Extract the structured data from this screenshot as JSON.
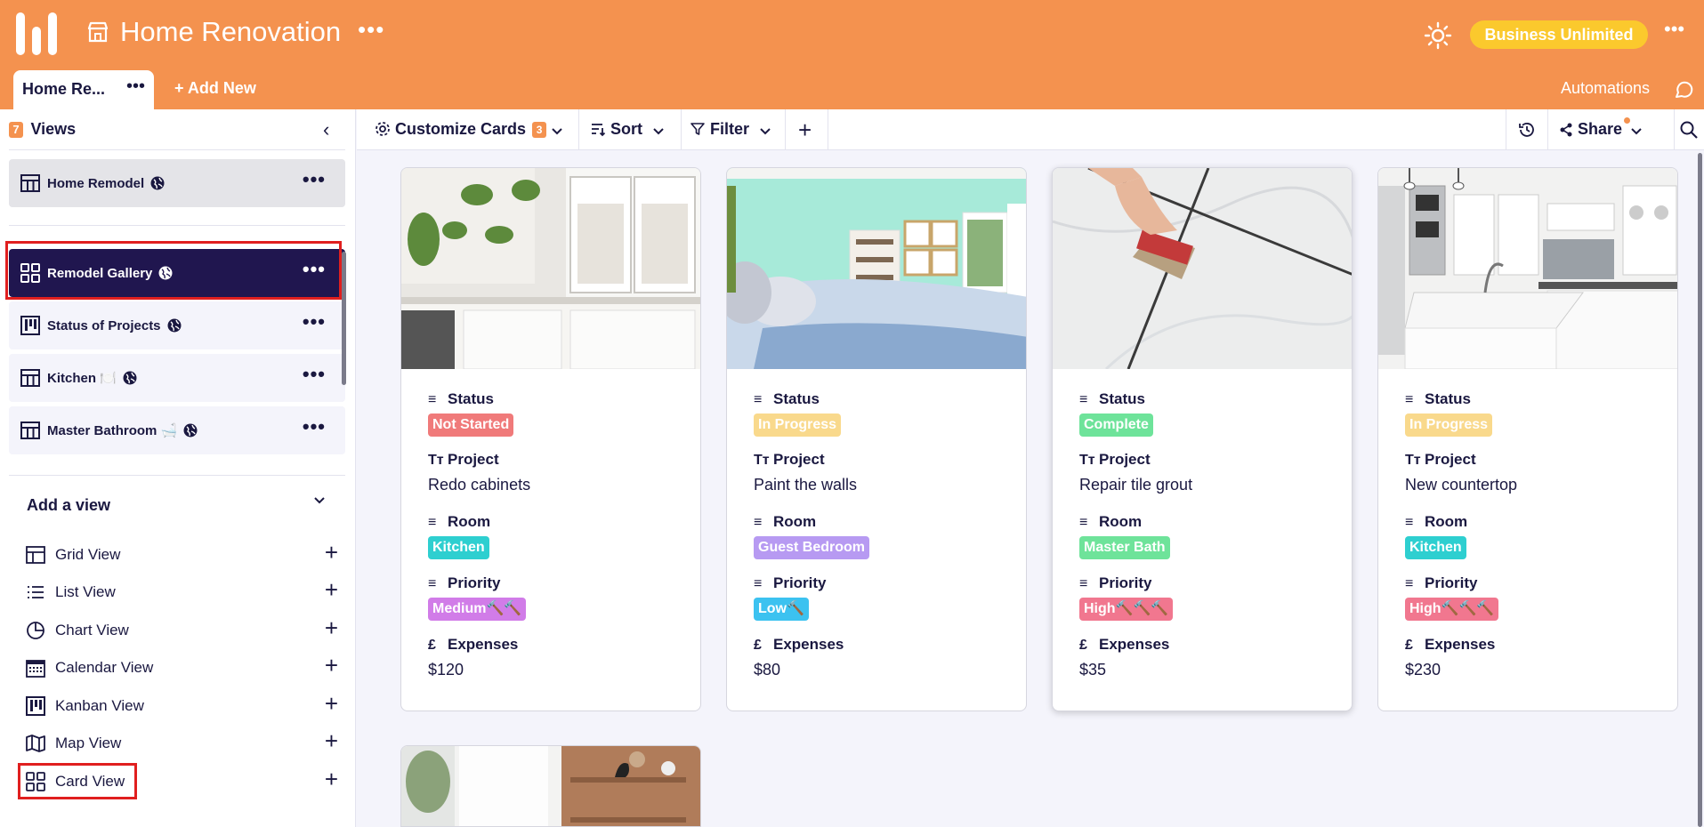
{
  "app": {
    "title": "Home Renovation",
    "plan": "Business Unlimited",
    "tab_active": "Home Re...",
    "add_new": "+ Add New",
    "automations": "Automations"
  },
  "sidebar": {
    "views_count": "7",
    "views_label": "Views",
    "views": [
      {
        "label": "Home Remodel",
        "icon": "grid-table-icon"
      },
      {
        "label": "Remodel Gallery",
        "icon": "gallery-icon",
        "active": true
      },
      {
        "label": "Status of Projects",
        "icon": "kanban-icon"
      },
      {
        "label": "Kitchen 🍽️",
        "icon": "grid-table-icon"
      },
      {
        "label": "Master Bathroom 🛁",
        "icon": "grid-table-icon"
      }
    ],
    "add_view_title": "Add a view",
    "add_views": [
      {
        "label": "Grid View",
        "icon": "grid-view-icon"
      },
      {
        "label": "List View",
        "icon": "list-view-icon"
      },
      {
        "label": "Chart View",
        "icon": "chart-view-icon"
      },
      {
        "label": "Calendar View",
        "icon": "calendar-view-icon"
      },
      {
        "label": "Kanban View",
        "icon": "kanban-view-icon"
      },
      {
        "label": "Map View",
        "icon": "map-view-icon"
      },
      {
        "label": "Card View",
        "icon": "card-view-icon"
      }
    ]
  },
  "toolbar": {
    "customize": "Customize Cards",
    "customize_count": "3",
    "sort": "Sort",
    "filter": "Filter",
    "share": "Share"
  },
  "field_labels": {
    "status": "Status",
    "project": "Project",
    "room": "Room",
    "priority": "Priority",
    "expenses": "Expenses"
  },
  "cards": [
    {
      "status": "Not Started",
      "status_color": "#f07a7a",
      "project": "Redo cabinets",
      "room": "Kitchen",
      "room_color": "#2ecfd0",
      "priority": "Medium🔨🔨",
      "priority_color": "#d17ce8",
      "expenses": "$120"
    },
    {
      "status": "In Progress",
      "status_color": "#f9d98c",
      "project": "Paint the walls",
      "room": "Guest Bedroom",
      "room_color": "#b79af2",
      "priority": "Low🔨",
      "priority_color": "#3cc2f0",
      "expenses": "$80"
    },
    {
      "status": "Complete",
      "status_color": "#6ee39a",
      "project": "Repair tile grout",
      "room": "Master Bath",
      "room_color": "#6ee39a",
      "priority": "High🔨🔨🔨",
      "priority_color": "#f1778f",
      "expenses": "$35"
    },
    {
      "status": "In Progress",
      "status_color": "#f9d98c",
      "project": "New countertop",
      "room": "Kitchen",
      "room_color": "#2ecfd0",
      "priority": "High🔨🔨🔨",
      "priority_color": "#f1778f",
      "expenses": "$230"
    }
  ]
}
